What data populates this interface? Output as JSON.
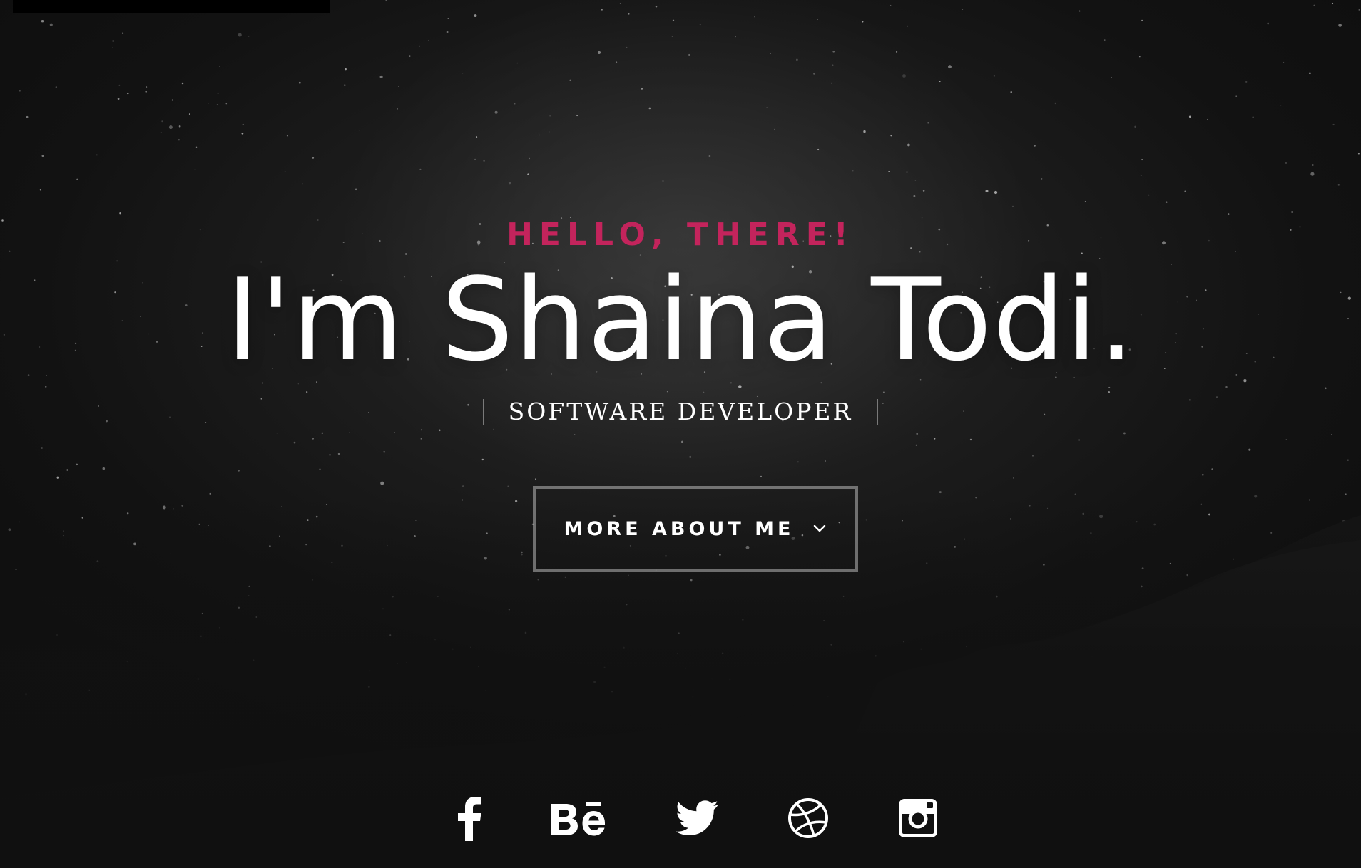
{
  "hero": {
    "greeting": "HELLO, THERE!",
    "headline": "I'm Shaina Todi.",
    "role": "SOFTWARE DEVELOPER",
    "cta_label": "MORE ABOUT ME",
    "cta_icon": "chevron-down-icon"
  },
  "social": {
    "links": [
      {
        "icon": "facebook-icon"
      },
      {
        "icon": "behance-icon"
      },
      {
        "icon": "twitter-icon"
      },
      {
        "icon": "dribbble-icon"
      },
      {
        "icon": "instagram-icon"
      }
    ]
  },
  "colors": {
    "accent": "#c3245c",
    "text": "#ffffff",
    "background": "#111111"
  }
}
